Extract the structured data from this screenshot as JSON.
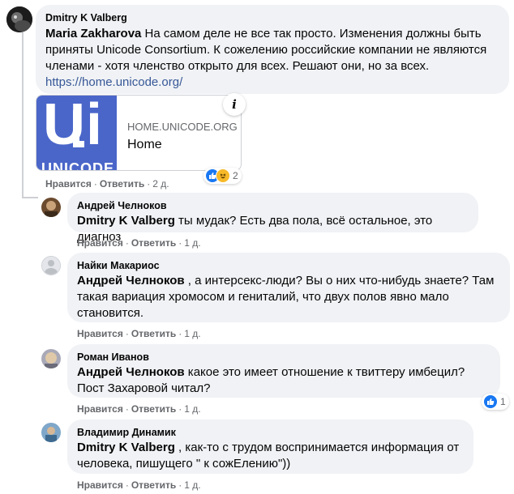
{
  "main_comment": {
    "author": "Dmitry K Valberg",
    "mention": "Maria Zakharova",
    "text": " На самом деле не все так просто. Изменения должны быть приняты Unicode Consortium. К сожелению российские компании не являются членами - хотя членство открыто для всех. Решают они, но за всех.",
    "link": "https://home.unicode.org/",
    "preview": {
      "logo_text": "UNICODE",
      "domain": "HOME.UNICODE.ORG",
      "title": "Home"
    },
    "reaction_count": "2",
    "actions": {
      "like": "Нравится",
      "reply": "Ответить",
      "time": "2 д."
    }
  },
  "replies": [
    {
      "author": "Андрей Челноков",
      "mention": "Dmitry K Valberg",
      "text": " ты мудак? Есть два пола, всё остальное, это диагноз",
      "actions": {
        "like": "Нравится",
        "reply": "Ответить",
        "time": "1 д."
      }
    },
    {
      "author": "Найки Макариос",
      "mention": "Андрей Челноков",
      "text": " , а интерсекс-люди? Вы о них что-нибудь знаете? Там такая вариация хромосом и гениталий, что двух полов явно мало становится.",
      "actions": {
        "like": "Нравится",
        "reply": "Ответить",
        "time": "1 д."
      }
    },
    {
      "author": "Роман Иванов",
      "mention": "Андрей Челноков",
      "text": " какое это имеет отношение к твиттеру имбецил? Пост Захаровой читал?",
      "reaction_count": "1",
      "actions": {
        "like": "Нравится",
        "reply": "Ответить",
        "time": "1 д."
      }
    },
    {
      "author": "Владимир Динамик",
      "mention": "Dmitry K Valberg",
      "text": " , как-то с трудом воспринимается информация от человека, пишущего \" к сожЕлению\"))",
      "actions": {
        "like": "Нравится",
        "reply": "Ответить",
        "time": "1 д."
      }
    }
  ],
  "colors": {
    "bubble": "#f0f2f5",
    "link": "#385898",
    "meta": "#65676b",
    "like_blue": "#1877f2",
    "haha_yellow": "#f7b928"
  },
  "icons": [
    "info-icon",
    "like-reaction-icon",
    "haha-reaction-icon"
  ]
}
